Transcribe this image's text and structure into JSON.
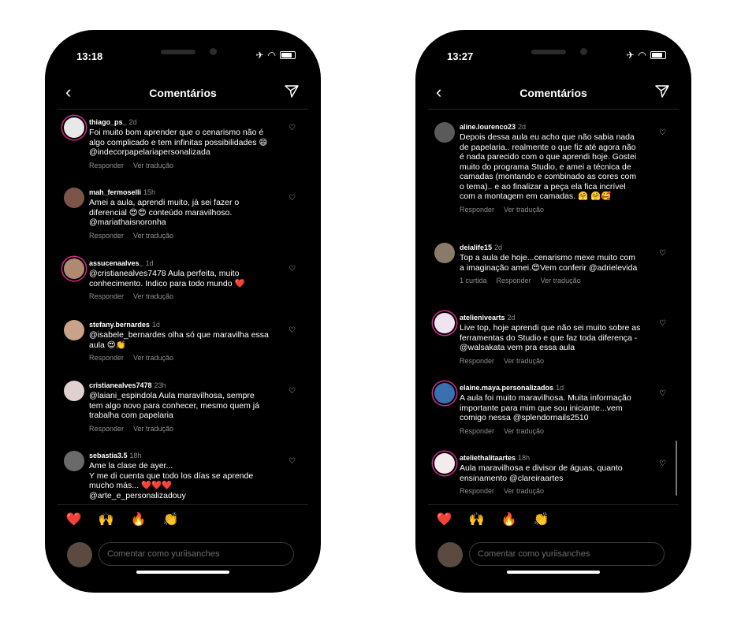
{
  "phones": [
    {
      "time": "13:18",
      "title": "Comentários",
      "emojis": [
        "❤️",
        "🙌",
        "🔥",
        "👏",
        "😢",
        "😍",
        "😮",
        "😂"
      ],
      "input_placeholder": "Comentar como yuriisanches",
      "comments": [
        {
          "user": "thiago_ps_",
          "age": "2d",
          "text": "Foi muito bom aprender que o cenarismo não é algo complicado e tem infinitas possibilidades 😄 @indecorpapelariapersonalizada",
          "actions": [
            "Responder",
            "Ver tradução"
          ],
          "avatar_color": "#e8e8e8"
        },
        {
          "user": "mah_fermoselli",
          "age": "15h",
          "text": "Amei a aula, aprendi muito, já sei fazer o diferencial 😍😍 conteúdo maravilhoso. @mariathaisnoronha",
          "actions": [
            "Responder",
            "Ver tradução"
          ],
          "avatar_color": "#7a5548"
        },
        {
          "user": "assucenaalves_",
          "age": "1d",
          "text": "@cristianealves7478 Aula perfeita, muito conhecimento. Indico para todo mundo ❤️",
          "actions": [
            "Responder",
            "Ver tradução"
          ],
          "avatar_color": "#b08a70"
        },
        {
          "user": "stefany.bernardes",
          "age": "1d",
          "text": "@isabele_bernardes olha só que maravilha essa aula 😍👏",
          "actions": [
            "Responder",
            "Ver tradução"
          ],
          "avatar_color": "#c9a28a"
        },
        {
          "user": "cristianealves7478",
          "age": "23h",
          "text": "@laiani_espindola Aula maravilhosa, sempre tem algo novo para conhecer, mesmo quem já trabalha com papelaria",
          "actions": [
            "Responder",
            "Ver tradução"
          ],
          "avatar_color": "#e0d0d0"
        },
        {
          "user": "sebastia3.5",
          "age": "18h",
          "text": "Ame la clase de ayer...\nY me di cuenta que todo los días se aprende mucho más... ❤️❤️❤️\n@arte_e_personalizadouy",
          "actions": [],
          "avatar_color": "#6a6a6a"
        }
      ]
    },
    {
      "time": "13:27",
      "title": "Comentários",
      "emojis": [
        "❤️",
        "🙌",
        "🔥",
        "👏",
        "😢",
        "😍",
        "😮",
        "😂"
      ],
      "input_placeholder": "Comentar como yuriisanches",
      "comments": [
        {
          "user": "aline.lourenco23",
          "age": "2d",
          "text": "Depois dessa aula eu acho que não sabia nada de papelaria.. realmente o que fiz até agora não é nada parecido com o que aprendi hoje. Gostei muito do programa Studio, e amei a técnica de camadas (montando e combinado as cores com o tema).. e ao finalizar a peça ela fica incrível com a montagem em camadas. 🤗 🤗🥰",
          "actions": [
            "Responder",
            "Ver tradução"
          ],
          "avatar_color": "#5a5a5a"
        },
        {
          "user": "deialife15",
          "age": "2d",
          "text": "Top a aula de hoje...cenarismo mexe muito com a imaginação amei.😍Vem conferir @adrielevida",
          "actions": [
            "1 curtida",
            "Responder",
            "Ver tradução"
          ],
          "avatar_color": "#8a7a6a"
        },
        {
          "user": "atelienivearts",
          "age": "2d",
          "text": "Live top, hoje aprendi que não sei muito sobre as ferramentas do Studio e que faz toda diferença - @walsakata vem pra essa aula",
          "actions": [
            "Responder",
            "Ver tradução"
          ],
          "avatar_color": "#f0e4f0"
        },
        {
          "user": "elaine.maya.personalizados",
          "age": "1d",
          "text": "A aula foi muito maravilhosa. Muita informação importante para mim que sou iniciante...vem comigo nessa @splendornails2510",
          "actions": [
            "Responder",
            "Ver tradução"
          ],
          "avatar_color": "#3a6fb0"
        },
        {
          "user": "ateliethalitaartes",
          "age": "18h",
          "text": "Aula maravilhosa e divisor de águas, quanto ensinamento @clareiraartes",
          "actions": [
            "Responder",
            "Ver tradução"
          ],
          "avatar_color": "#f4ecec"
        }
      ]
    }
  ]
}
